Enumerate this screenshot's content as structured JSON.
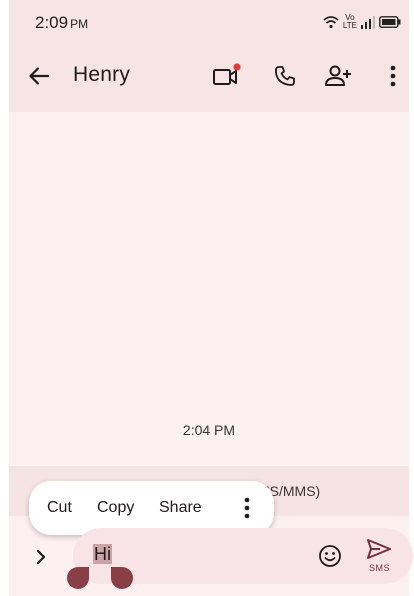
{
  "status": {
    "time": "2:09",
    "ampm": "PM",
    "volte_top": "Vo",
    "volte_bottom": "LTE"
  },
  "appbar": {
    "title": "Henry",
    "back_icon": "arrow-left-icon",
    "video_icon": "video-call-icon",
    "call_icon": "phone-icon",
    "add_person_icon": "add-person-icon",
    "more_icon": "more-vert-icon"
  },
  "conversation": {
    "timestamp": "2:04 PM",
    "hint": "MS/MMS)"
  },
  "context_menu": {
    "cut": "Cut",
    "copy": "Copy",
    "share": "Share"
  },
  "compose": {
    "text": "Hi",
    "send_label": "SMS"
  },
  "colors": {
    "background": "#fdf0f0",
    "appbar": "#f7e5e6",
    "accent": "#7a2f3c",
    "recording_dot": "#e53935"
  }
}
